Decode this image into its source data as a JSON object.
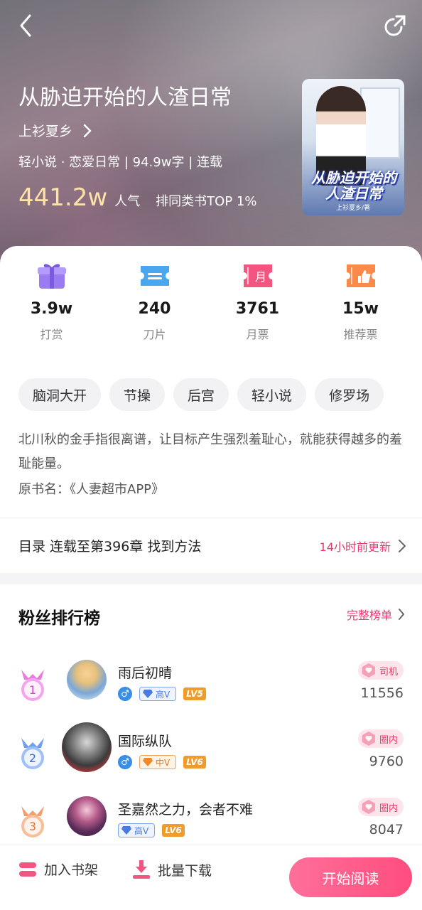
{
  "hero": {
    "title": "从胁迫开始的人渣日常",
    "author": "上衫夏乡",
    "meta": "轻小说 · 恋爱日常 | 94.9w字 | 连载",
    "popularity_value": "441.2w",
    "popularity_label": "人气",
    "rank_text": "排同类书TOP 1%",
    "cover_title": "从胁迫开始的人渣日常",
    "cover_author": "上衫夏乡/著"
  },
  "gifts": [
    {
      "value": "3.9w",
      "label": "打赏",
      "icon": "gift-icon"
    },
    {
      "value": "240",
      "label": "刀片",
      "icon": "blade-icon"
    },
    {
      "value": "3761",
      "label": "月票",
      "icon": "monthly-ticket-icon",
      "icon_text": "月"
    },
    {
      "value": "15w",
      "label": "推荐票",
      "icon": "thumbs-up-ticket-icon"
    }
  ],
  "tags": [
    "脑洞大开",
    "节操",
    "后宫",
    "轻小说",
    "修罗场"
  ],
  "description": "北川秋的金手指很离谱，让目标产生强烈羞耻心，就能获得越多的羞耻能量。",
  "original_name": "原书名：《人妻超市APP》",
  "toc": {
    "text": "目录 连载至第396章 找到方法",
    "update": "14小时前更新"
  },
  "fans": {
    "title": "粉丝排行榜",
    "more": "完整榜单",
    "items": [
      {
        "rank": "1",
        "name": "雨后初晴",
        "gender": "♂",
        "vip": "高V",
        "level": "LV5",
        "title_badge": "司机",
        "score": "11556"
      },
      {
        "rank": "2",
        "name": "国际纵队",
        "gender": "♂",
        "vip": "中V",
        "level": "LV6",
        "title_badge": "圈内",
        "score": "9760"
      },
      {
        "rank": "3",
        "name": "圣嘉然之力，会者不难",
        "gender": "",
        "vip": "高V",
        "level": "LV6",
        "title_badge": "圈内",
        "score": "8047"
      }
    ]
  },
  "bottom": {
    "shelf": "加入书架",
    "download": "批量下载",
    "read": "开始阅读"
  },
  "colors": {
    "accent": "#e8386c",
    "read_button": "#ff5a86",
    "popularity": "#ffe3a6"
  }
}
